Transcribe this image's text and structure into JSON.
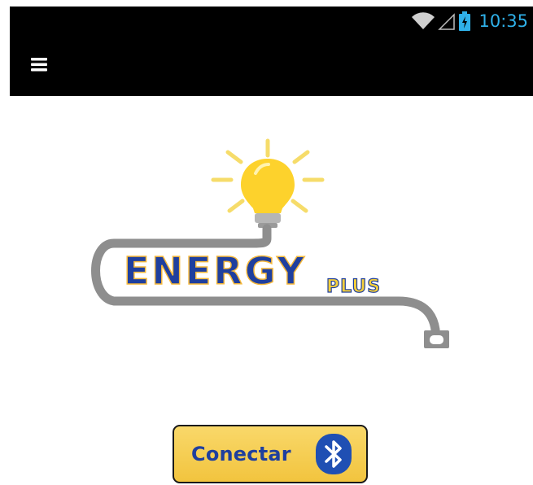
{
  "status_bar": {
    "time": "10:35",
    "icons": [
      "wifi-icon",
      "signal-icon",
      "battery-charging-icon"
    ],
    "time_color": "#2fb0e8"
  },
  "app_bar": {
    "menu_icon": "hamburger-menu-icon",
    "background": "#000000"
  },
  "logo": {
    "word_main": "ENERGY",
    "word_sub": "PLUS",
    "icons": [
      "light-bulb-icon",
      "cable-icon",
      "plug-icon"
    ]
  },
  "connect_button": {
    "label": "Conectar",
    "icon": "bluetooth-icon",
    "background": "#f2c43e",
    "text_color": "#1f3f9e"
  }
}
